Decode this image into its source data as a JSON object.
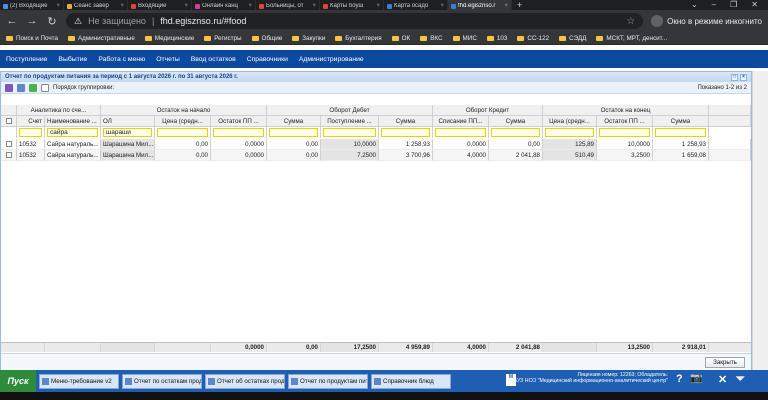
{
  "browser": {
    "tabs": [
      {
        "label": "(2) Входящие",
        "color": "#4a90e2"
      },
      {
        "label": "Сеанс завер",
        "color": "#e0b040"
      },
      {
        "label": "Входящие",
        "color": "#e04040"
      },
      {
        "label": "Онлайн канц",
        "color": "#d04090"
      },
      {
        "label": "Больницы, от",
        "color": "#e04040"
      },
      {
        "label": "Карты боуш",
        "color": "#e04040"
      },
      {
        "label": "Карта осадо",
        "color": "#3a80d0"
      },
      {
        "label": "fhd.egisznso.r",
        "color": "#3a80d0"
      }
    ],
    "new_tab": "+",
    "window_controls": [
      "⌄",
      "–",
      "❐",
      "✕"
    ],
    "nav": {
      "back": "←",
      "forward": "→",
      "reload": "↻"
    },
    "address": {
      "warning": "⚠",
      "insecure_label": "Не защищено",
      "url": "fhd.egisznso.ru/#food",
      "star": "☆"
    },
    "incognito_label": "Окно в режиме инкогнито",
    "bookmarks": [
      "Поиск и Почта",
      "Административные",
      "Медицинские",
      "Регистры",
      "Общие",
      "Закупки",
      "Бухгалтерия",
      "ОК",
      "ВКС",
      "МИС",
      "103",
      "СС-122",
      "СЭДД",
      "МСКТ, МРТ, денсит..."
    ]
  },
  "app_menu": [
    "Поступление",
    "Выбытие",
    "Работа с меню",
    "Отчеты",
    "Ввод остатков",
    "Справочники",
    "Администрирование"
  ],
  "report": {
    "title": "Отчет по продуктам питания за период с 1 августа 2026 г. по 31 августа 2026 г.",
    "grouping_label": "Порядок группировки:",
    "shown_label": "Показано 1-2 из 2",
    "group_headers": [
      "Аналитика по сче...",
      "Остаток на начало",
      "Оборот Дебет",
      "Оборот Кредит",
      "Остаток на конец"
    ],
    "columns": [
      "Счет",
      "Наименование ...",
      "ОЛ",
      "Цена (средн...",
      "Остаток ПП ...",
      "Сумма",
      "Поступление ...",
      "Сумма",
      "Списание ПП...",
      "Сумма",
      "Цена (средн...",
      "Остаток ПП ...",
      "Сумма"
    ],
    "filters": [
      "",
      "сайра",
      "шараши",
      "",
      "",
      "",
      "",
      "",
      "",
      "",
      "",
      "",
      ""
    ],
    "rows": [
      [
        "10532",
        "Сайра натураль...",
        "Шарашина Мил...",
        "0,00",
        "0,0000",
        "0,00",
        "10,0000",
        "1 258,93",
        "0,0000",
        "0,00",
        "125,89",
        "10,0000",
        "1 258,93"
      ],
      [
        "10532",
        "Сайра натураль...",
        "Шарашина Мил...",
        "0,00",
        "0,0000",
        "0,00",
        "7,2500",
        "3 700,96",
        "4,0000",
        "2 041,88",
        "510,49",
        "3,2500",
        "1 659,08"
      ]
    ],
    "totals": [
      "",
      "",
      "",
      "",
      "0,0000",
      "0,00",
      "17,2500",
      "4 959,89",
      "4,0000",
      "2 041,88",
      "",
      "13,2500",
      "2 918,01"
    ],
    "close_label": "Закрыть"
  },
  "taskbar": {
    "start_label": "Пуск",
    "items": [
      "Меню-требование v2",
      "Отчет по остаткам продуктов",
      "Отчет об остатках продукто...",
      "Отчет по продуктам питания...",
      "Справочник блюд"
    ],
    "license_line1": "Лицензия номер: 12263; Обладатель:",
    "license_line2": "ГБУЗ НСО \"Медицинский информационно-аналитический центр\"",
    "tray": [
      "?",
      "📷",
      "✕",
      "⏷"
    ]
  }
}
